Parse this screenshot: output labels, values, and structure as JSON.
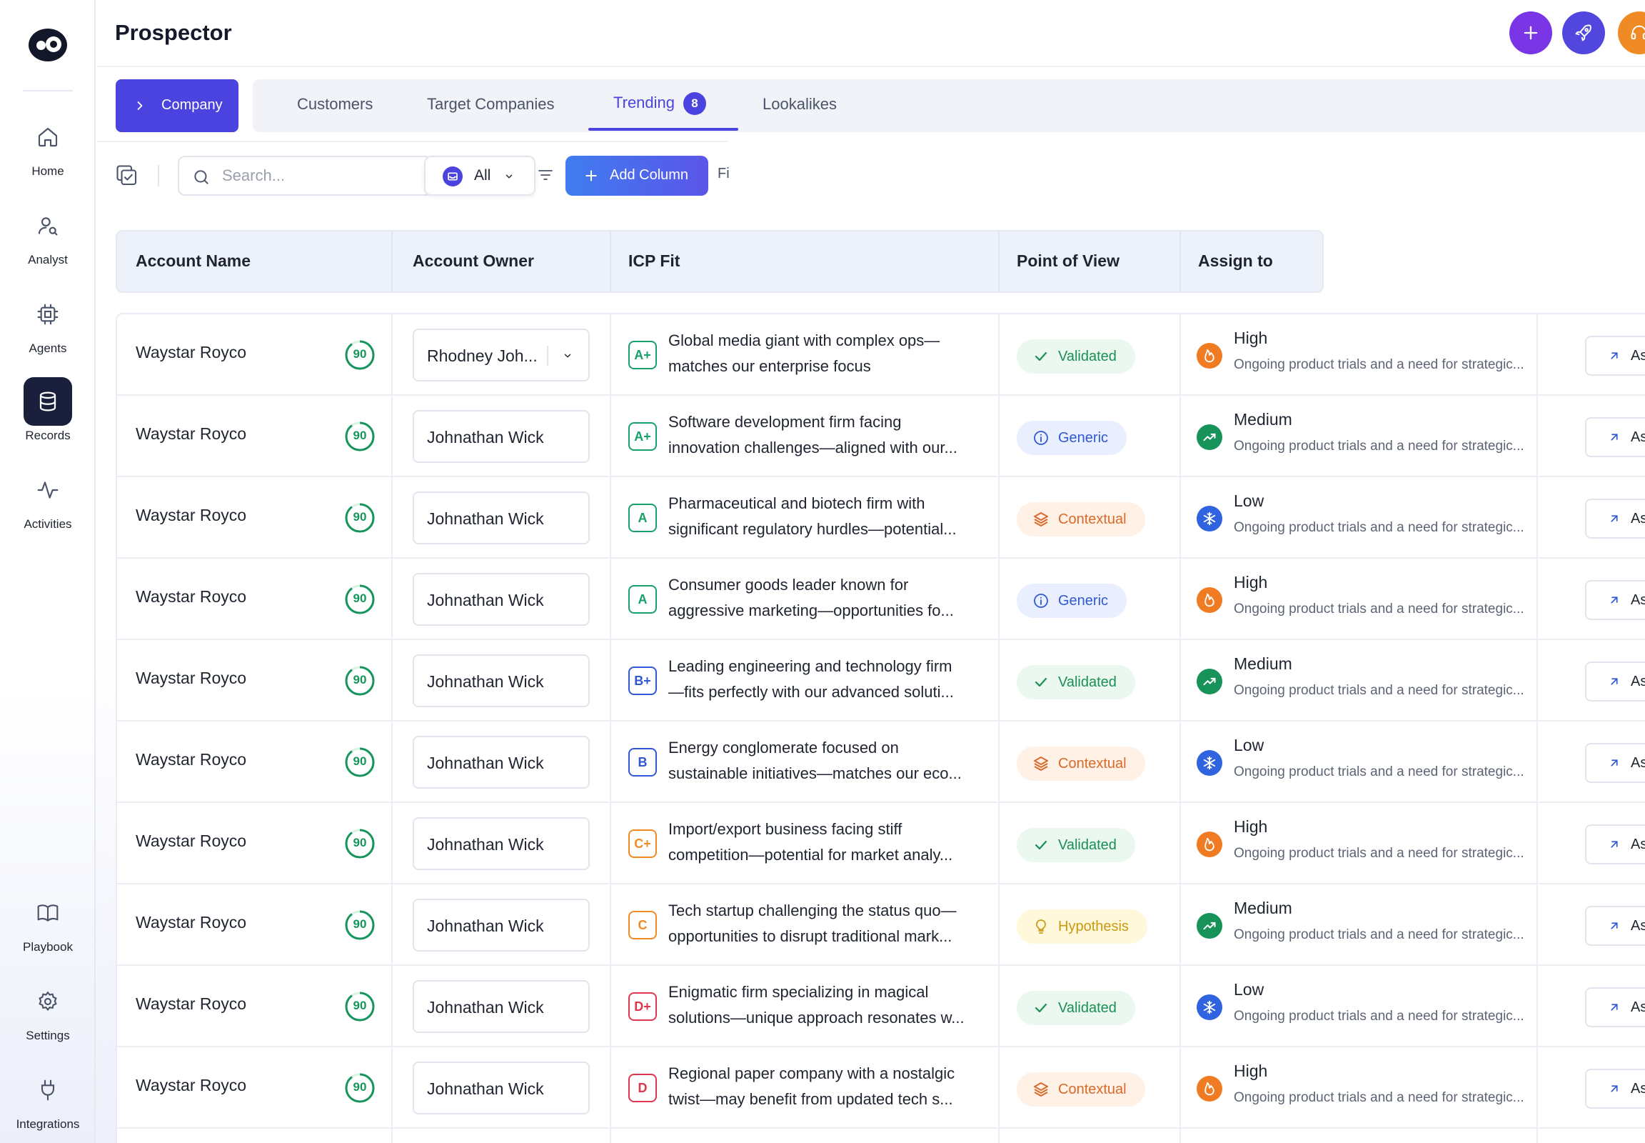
{
  "app": {
    "title": "Prospector"
  },
  "sidebar": {
    "items": [
      {
        "label": "Home",
        "icon": "home-icon"
      },
      {
        "label": "Analyst",
        "icon": "analyst-icon"
      },
      {
        "label": "Agents",
        "icon": "chip-icon"
      },
      {
        "label": "Records",
        "icon": "database-icon",
        "active": true
      },
      {
        "label": "Activities",
        "icon": "activity-icon"
      },
      {
        "label": "Playbook",
        "icon": "book-icon"
      },
      {
        "label": "Settings",
        "icon": "gear-icon"
      },
      {
        "label": "Integrations",
        "icon": "plug-icon"
      }
    ]
  },
  "header": {
    "buttons": [
      {
        "name": "add",
        "icon": "plus-icon",
        "color": "#7a35e6"
      },
      {
        "name": "launch",
        "icon": "rocket-icon",
        "color": "#5147df"
      },
      {
        "name": "support",
        "icon": "headset-icon",
        "color": "#f08a24"
      }
    ]
  },
  "tabs": {
    "company_label": "Company",
    "items": [
      {
        "label": "Customers"
      },
      {
        "label": "Target Companies"
      },
      {
        "label": "Trending",
        "badge": "8",
        "active": true
      },
      {
        "label": "Lookalikes"
      }
    ]
  },
  "toolbar": {
    "search_placeholder": "Search...",
    "filter_value": "All",
    "add_column_label": "Add Column",
    "truncated_label": "Fi"
  },
  "table": {
    "columns": [
      "Account Name",
      "Account Owner",
      "ICP Fit",
      "Point of View",
      "Assign to"
    ],
    "assign_label": "As",
    "rows": [
      {
        "account": "Waystar Royco",
        "score": "90",
        "owner": "Rhodney Joh...",
        "owner_dropdown": true,
        "grade": "A+",
        "grade_color": "#16a06a",
        "icp1": "Global media giant with complex ops—",
        "icp2": "matches our enterprise focus",
        "pov": "Validated",
        "pov_type": "validated",
        "priority": "High",
        "priority_type": "high",
        "priority_desc": "Ongoing product trials and a need for strategic..."
      },
      {
        "account": "Waystar Royco",
        "score": "90",
        "owner": "Johnathan Wick",
        "grade": "A+",
        "grade_color": "#16a06a",
        "icp1": "Software development firm facing",
        "icp2": "innovation challenges—aligned with our...",
        "pov": "Generic",
        "pov_type": "generic",
        "priority": "Medium",
        "priority_type": "medium",
        "priority_desc": "Ongoing product trials and a need for strategic..."
      },
      {
        "account": "Waystar Royco",
        "score": "90",
        "owner": "Johnathan Wick",
        "grade": "A",
        "grade_color": "#16a06a",
        "icp1": "Pharmaceutical and biotech firm with",
        "icp2": "significant regulatory hurdles—potential...",
        "pov": "Contextual",
        "pov_type": "contextual",
        "priority": "Low",
        "priority_type": "low",
        "priority_desc": "Ongoing product trials and a need for strategic..."
      },
      {
        "account": "Waystar Royco",
        "score": "90",
        "owner": "Johnathan Wick",
        "grade": "A",
        "grade_color": "#16a06a",
        "icp1": "Consumer goods leader known for",
        "icp2": "aggressive marketing—opportunities fo...",
        "pov": "Generic",
        "pov_type": "generic",
        "priority": "High",
        "priority_type": "high",
        "priority_desc": "Ongoing product trials and a need for strategic..."
      },
      {
        "account": "Waystar Royco",
        "score": "90",
        "owner": "Johnathan Wick",
        "grade": "B+",
        "grade_color": "#3057d5",
        "icp1": "Leading engineering and technology firm",
        "icp2": "—fits perfectly with our advanced soluti...",
        "pov": "Validated",
        "pov_type": "validated",
        "priority": "Medium",
        "priority_type": "medium",
        "priority_desc": "Ongoing product trials and a need for strategic..."
      },
      {
        "account": "Waystar Royco",
        "score": "90",
        "owner": "Johnathan Wick",
        "grade": "B",
        "grade_color": "#3057d5",
        "icp1": "Energy conglomerate focused on",
        "icp2": "sustainable initiatives—matches our eco...",
        "pov": "Contextual",
        "pov_type": "contextual",
        "priority": "Low",
        "priority_type": "low",
        "priority_desc": "Ongoing product trials and a need for strategic..."
      },
      {
        "account": "Waystar Royco",
        "score": "90",
        "owner": "Johnathan Wick",
        "grade": "C+",
        "grade_color": "#f08a24",
        "icp1": "Import/export business facing stiff",
        "icp2": "competition—potential for market analy...",
        "pov": "Validated",
        "pov_type": "validated",
        "priority": "High",
        "priority_type": "high",
        "priority_desc": "Ongoing product trials and a need for strategic..."
      },
      {
        "account": "Waystar Royco",
        "score": "90",
        "owner": "Johnathan Wick",
        "grade": "C",
        "grade_color": "#f08a24",
        "icp1": "Tech startup challenging the status quo—",
        "icp2": "opportunities to disrupt traditional mark...",
        "pov": "Hypothesis",
        "pov_type": "hypothesis",
        "priority": "Medium",
        "priority_type": "medium",
        "priority_desc": "Ongoing product trials and a need for strategic..."
      },
      {
        "account": "Waystar Royco",
        "score": "90",
        "owner": "Johnathan Wick",
        "grade": "D+",
        "grade_color": "#e0364d",
        "icp1": "Enigmatic firm specializing in magical",
        "icp2": "solutions—unique approach resonates w...",
        "pov": "Validated",
        "pov_type": "validated",
        "priority": "Low",
        "priority_type": "low",
        "priority_desc": "Ongoing product trials and a need for strategic..."
      },
      {
        "account": "Waystar Royco",
        "score": "90",
        "owner": "Johnathan Wick",
        "grade": "D",
        "grade_color": "#e0364d",
        "icp1": "Regional paper company with a nostalgic",
        "icp2": "twist—may benefit from updated tech s...",
        "pov": "Contextual",
        "pov_type": "contextual",
        "priority": "High",
        "priority_type": "high",
        "priority_desc": "Ongoing product trials and a need for strategic..."
      }
    ]
  }
}
